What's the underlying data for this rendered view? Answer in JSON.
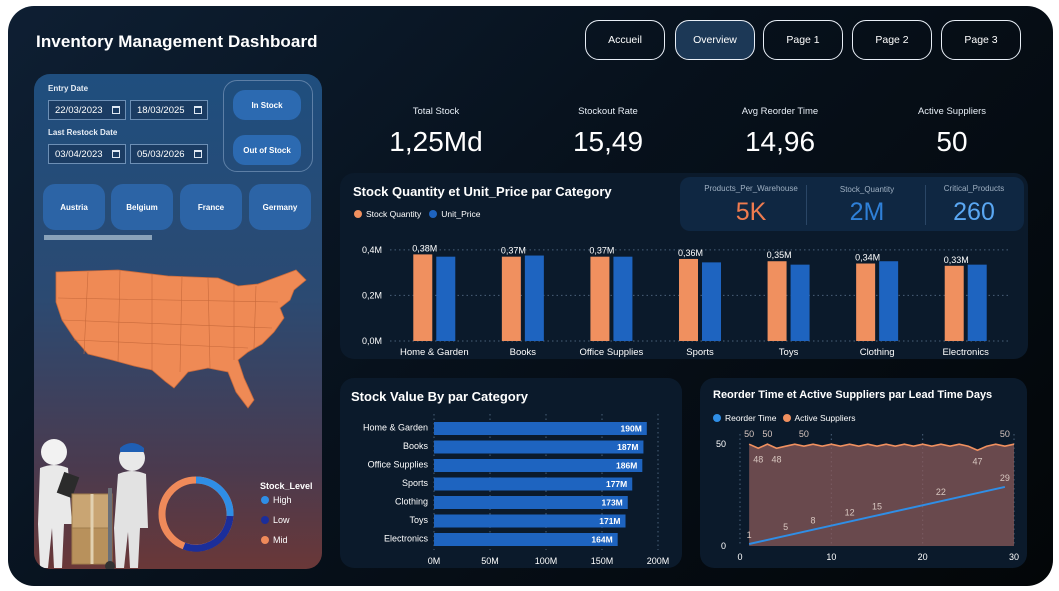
{
  "header": {
    "title": "Inventory Management Dashboard"
  },
  "nav": {
    "items": [
      "Accueil",
      "Overview",
      "Page 1",
      "Page 2",
      "Page 3"
    ],
    "active": "Overview"
  },
  "filters": {
    "entry_date": {
      "label": "Entry Date",
      "from": "22/03/2023",
      "to": "18/03/2025"
    },
    "last_restock_date": {
      "label": "Last Restock Date",
      "from": "03/04/2023",
      "to": "05/03/2026"
    },
    "stock_status": [
      "In Stock",
      "Out of Stock"
    ],
    "countries": [
      "Austria",
      "Belgium",
      "France",
      "Germany"
    ]
  },
  "kpis": [
    {
      "label": "Total Stock",
      "value": "1,25Md"
    },
    {
      "label": "Stockout Rate",
      "value": "15,49"
    },
    {
      "label": "Avg Reorder Time",
      "value": "14,96"
    },
    {
      "label": "Active Suppliers",
      "value": "50"
    }
  ],
  "mini_kpis": [
    {
      "label": "Products_Per_Warehouse",
      "value": "5K",
      "color": "#ef7b4f"
    },
    {
      "label": "Stock_Quantity",
      "value": "2M",
      "color": "#2f80d8"
    },
    {
      "label": "Critical_Products",
      "value": "260",
      "color": "#5aa7f2"
    }
  ],
  "stock_level": {
    "title": "Stock_Level",
    "items": [
      {
        "label": "High",
        "color": "#2f8ee6"
      },
      {
        "label": "Low",
        "color": "#1b2e9a"
      },
      {
        "label": "Mid",
        "color": "#ef8a5a"
      }
    ]
  },
  "colors": {
    "orange": "#f0905f",
    "blue": "#1e64c0",
    "bright_blue": "#2f8ee6"
  },
  "chart_data": [
    {
      "type": "bar",
      "title": "Stock Quantity et Unit_Price par Category",
      "categories": [
        "Home & Garden",
        "Books",
        "Office Supplies",
        "Sports",
        "Toys",
        "Clothing",
        "Electronics"
      ],
      "series": [
        {
          "name": "Stock Quantity",
          "values": [
            0.38,
            0.37,
            0.37,
            0.36,
            0.35,
            0.34,
            0.33
          ],
          "labels": [
            "0,38M",
            "0,37M",
            "0,37M",
            "0,36M",
            "0,35M",
            "0,34M",
            "0,33M"
          ]
        },
        {
          "name": "Unit_Price",
          "values": [
            0.37,
            0.375,
            0.37,
            0.345,
            0.335,
            0.35,
            0.335
          ]
        }
      ],
      "yticks": [
        "0,0M",
        "0,2M",
        "0,4M"
      ],
      "ylim": [
        0,
        0.43
      ]
    },
    {
      "type": "bar",
      "orientation": "horizontal",
      "title": "Stock Value By par Category",
      "categories": [
        "Home & Garden",
        "Books",
        "Office Supplies",
        "Sports",
        "Clothing",
        "Toys",
        "Electronics"
      ],
      "values": [
        190,
        187,
        186,
        177,
        173,
        171,
        164
      ],
      "labels": [
        "190M",
        "187M",
        "186M",
        "177M",
        "173M",
        "171M",
        "164M"
      ],
      "xticks": [
        "0M",
        "50M",
        "100M",
        "150M",
        "200M"
      ],
      "xlim": [
        0,
        200
      ]
    },
    {
      "type": "line",
      "title": "Reorder Time et Active Suppliers par Lead Time Days",
      "series": [
        {
          "name": "Reorder Time",
          "x": [
            1,
            5,
            8,
            12,
            15,
            22,
            29
          ],
          "y": [
            1,
            5,
            8,
            12,
            15,
            22,
            29
          ],
          "labels": [
            "1",
            "5",
            "8",
            "12",
            "15",
            "22",
            "29"
          ]
        },
        {
          "name": "Active Suppliers",
          "x": [
            1,
            2,
            3,
            4,
            5,
            6,
            7,
            8,
            9,
            10,
            11,
            12,
            13,
            14,
            15,
            16,
            17,
            18,
            19,
            20,
            21,
            22,
            23,
            24,
            25,
            26,
            27,
            28,
            29,
            30
          ],
          "y": [
            50,
            48,
            50,
            48,
            49,
            50,
            49,
            50,
            49,
            50,
            49,
            50,
            49,
            50,
            49,
            50,
            49,
            50,
            49,
            50,
            49,
            50,
            49,
            50,
            49,
            47,
            49,
            50,
            49,
            50
          ]
        }
      ],
      "point_labels": [
        {
          "x": 1,
          "y": 50,
          "text": "50"
        },
        {
          "x": 3,
          "y": 50,
          "text": "50"
        },
        {
          "x": 7,
          "y": 50,
          "text": "50"
        },
        {
          "x": 29,
          "y": 50,
          "text": "50"
        },
        {
          "x": 2,
          "y": 48,
          "text": "48"
        },
        {
          "x": 4,
          "y": 48,
          "text": "48"
        },
        {
          "x": 26,
          "y": 47,
          "text": "47"
        }
      ],
      "xticks": [
        0,
        10,
        20,
        30
      ],
      "yticks": [
        0,
        50
      ],
      "xlim": [
        0,
        30
      ],
      "ylim": [
        0,
        55
      ]
    }
  ]
}
